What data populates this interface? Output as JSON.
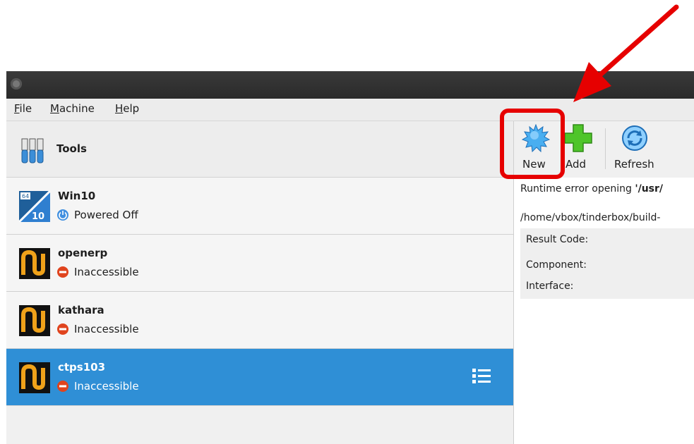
{
  "menubar": {
    "file": "File",
    "file_u": "F",
    "file_rest": "ile",
    "machine": "Machine",
    "machine_u": "M",
    "machine_rest": "achine",
    "help": "Help",
    "help_u": "H",
    "help_rest": "elp"
  },
  "tools": {
    "label": "Tools"
  },
  "vms": [
    {
      "name": "Win10",
      "state": "Powered Off",
      "os_badge": "64",
      "os_num": "10"
    },
    {
      "name": "openerp",
      "state": "Inaccessible"
    },
    {
      "name": "kathara",
      "state": "Inaccessible"
    },
    {
      "name": "ctps103",
      "state": "Inaccessible"
    }
  ],
  "toolbar": {
    "new_label": "New",
    "add_label": "Add",
    "refresh_label": "Refresh"
  },
  "error": {
    "line1_prefix": "Runtime error opening ",
    "line1_path": "'/usr/",
    "line2": "/home/vbox/tinderbox/build-",
    "result_code_label": "Result Code:",
    "component_label": "Component:",
    "interface_label": "Interface:"
  },
  "colors": {
    "selection": "#2f8fd6",
    "highlight": "#e60000",
    "arrow": "#e60000"
  }
}
